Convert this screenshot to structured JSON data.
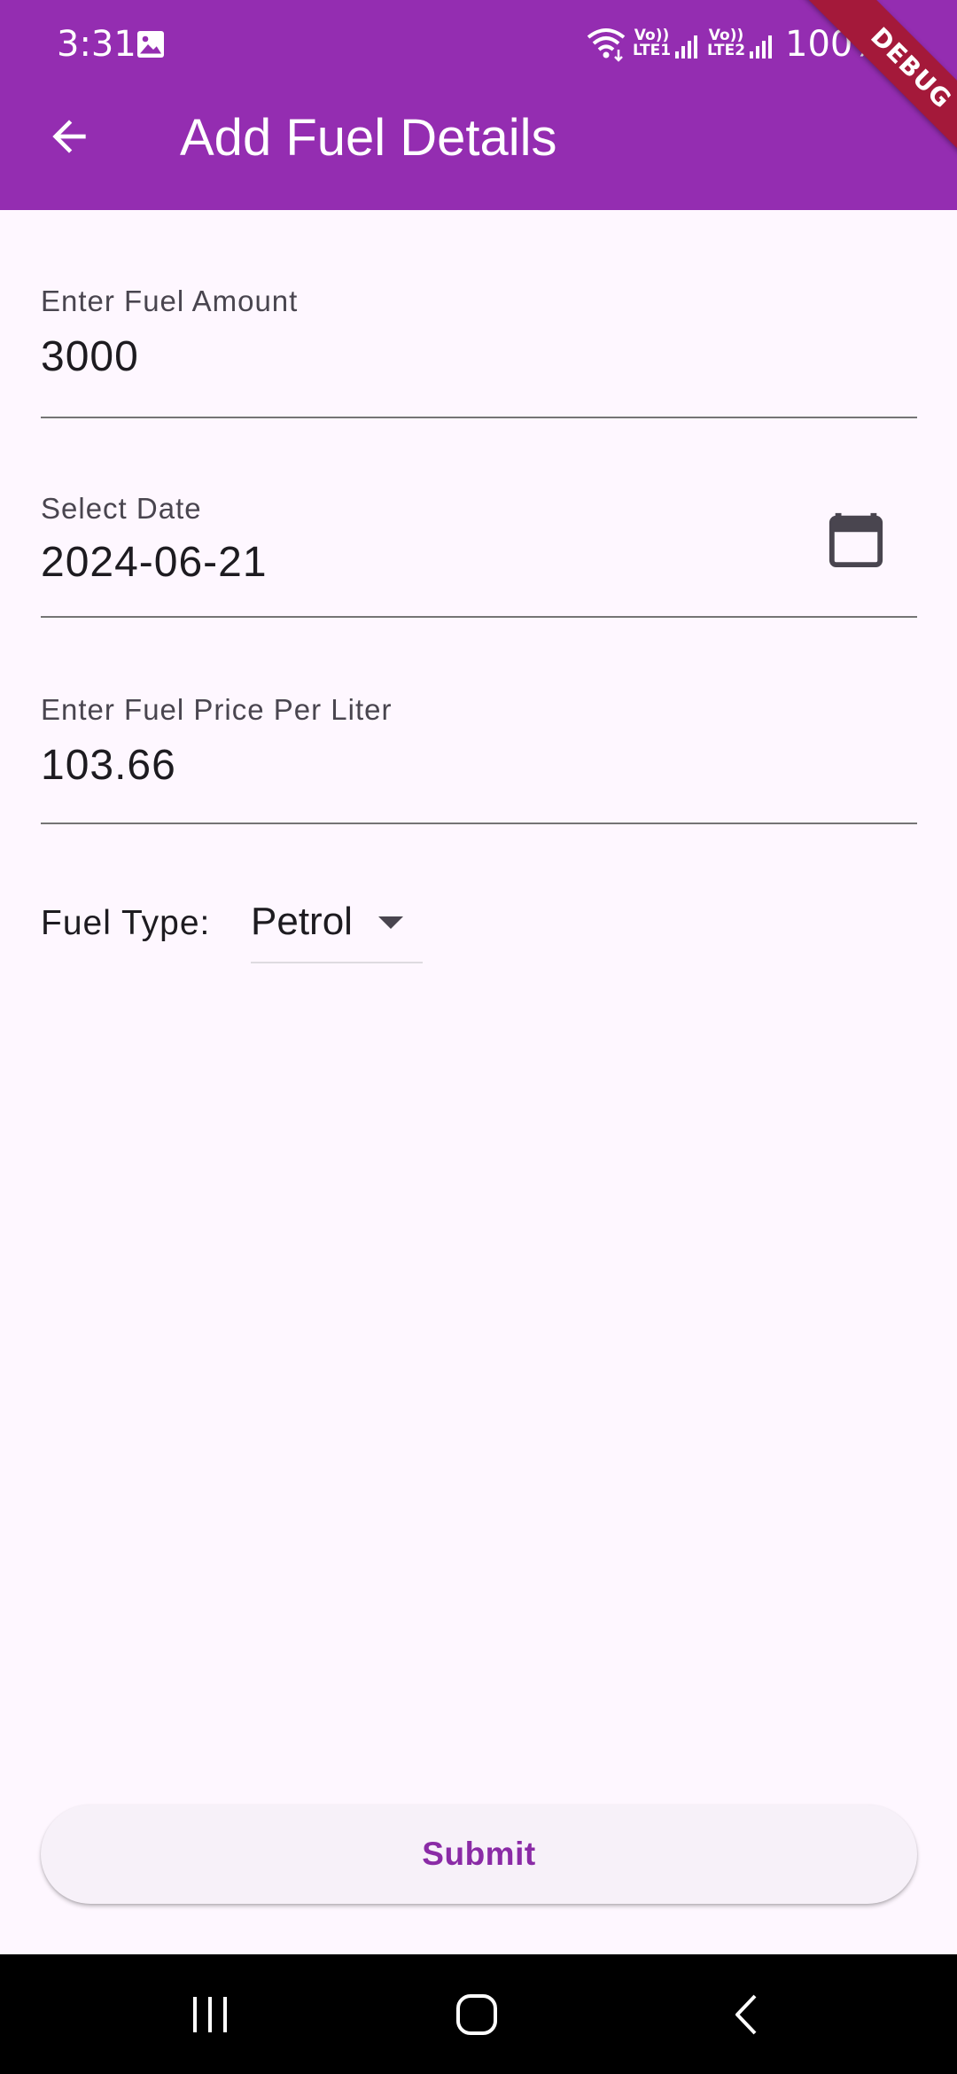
{
  "status_bar": {
    "time": "3:31",
    "sim1": "Vo))\nLTE1",
    "sim1_top": "Vo))",
    "sim1_bottom": "LTE1",
    "sim2_top": "Vo))",
    "sim2_bottom": "LTE2",
    "battery": "100%",
    "icons": [
      "gallery-icon",
      "wifi-icon",
      "signal-icon",
      "signal-icon"
    ]
  },
  "app_bar": {
    "title": "Add Fuel Details",
    "back_icon": "arrow-back-icon",
    "background_color": "#942db1"
  },
  "debug_banner": "DEBUG",
  "form": {
    "amount": {
      "label": "Enter Fuel Amount",
      "value": "3000"
    },
    "date": {
      "label": "Select Date",
      "value": "2024-06-21",
      "icon": "calendar-icon"
    },
    "price": {
      "label": "Enter Fuel Price Per Liter",
      "value": "103.66"
    },
    "fuel_type": {
      "label": "Fuel Type:",
      "selected": "Petrol",
      "icon": "dropdown-arrow-icon"
    }
  },
  "submit": {
    "label": "Submit",
    "color": "#8a2ba6"
  },
  "nav_bar": {
    "icons": [
      "recents-icon",
      "home-icon",
      "back-icon"
    ]
  }
}
